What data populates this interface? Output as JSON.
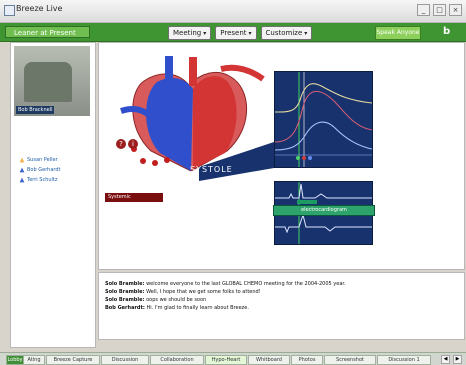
{
  "window": {
    "title": "Breeze Live",
    "controls": [
      "_",
      "□",
      "×"
    ]
  },
  "toolbar": {
    "breadcrumb": "Leaner at Present",
    "dropdowns": [
      "Meeting",
      "Present",
      "Customize"
    ],
    "user_button": "Speak Anyone",
    "logo": "b"
  },
  "sidebar": {
    "video_label": "Bob Bracknell",
    "participants": [
      {
        "name": "Susan Peller",
        "icon_color": "#f3b34c"
      },
      {
        "name": "Bob Gerhardt",
        "icon_color": "#3b66c6"
      },
      {
        "name": "Terri Schultz",
        "icon_color": "#3b66c6"
      }
    ]
  },
  "content": {
    "diagram_label": "SYSTOLE",
    "dropdown": "Systemic",
    "ecg_label": "electrocardiogram",
    "icons": {
      "close": "close-icon",
      "info": "info-icon"
    }
  },
  "transcript": {
    "lines": [
      {
        "speaker": "Solo Bramble:",
        "text": "welcome everyone to the last GLOBAL CHEMO meeting for the 2004-2005 year."
      },
      {
        "speaker": "Solo Bramble:",
        "text": "Well, I hope that we get some folks to attend!"
      },
      {
        "speaker": "Solo Bramble:",
        "text": "oops we should be soon"
      },
      {
        "speaker": "Bob Gerhardt:",
        "text": "Hi. I'm glad to finally learn about Breeze."
      }
    ]
  },
  "tabs": [
    {
      "label": "Lobby",
      "active": true
    },
    {
      "label": "Ating"
    },
    {
      "label": "Breeze Capture"
    },
    {
      "label": "Discussion"
    },
    {
      "label": "Collaboration"
    },
    {
      "label": "Hypo-Heart",
      "active2": true
    },
    {
      "label": "Whitboard"
    },
    {
      "label": "Photos"
    },
    {
      "label": "Screenshot"
    },
    {
      "label": "Discussion 1"
    }
  ]
}
